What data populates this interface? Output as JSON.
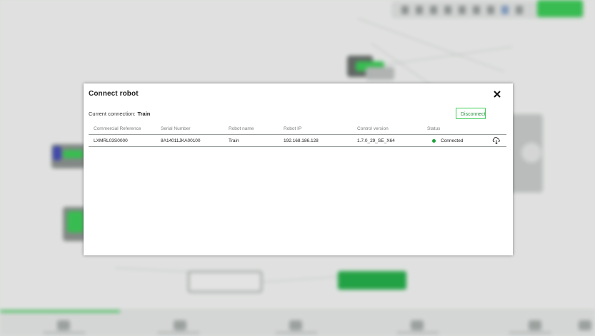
{
  "dialog": {
    "title": "Connect robot",
    "close_icon": "close-icon",
    "current_connection_label": "Current connection:",
    "current_connection_value": "Train",
    "disconnect_label": "Disconnect"
  },
  "table": {
    "columns": [
      "Commercial Reference",
      "Serial Number",
      "Robot name",
      "Robot IP",
      "Control version",
      "Status"
    ],
    "rows": [
      {
        "commercial_reference": "LXMRL03S0000",
        "serial_number": "8A14011JKA00100",
        "robot_name": "Train",
        "robot_ip": "192.168.186.128",
        "control_version": "1.7.0_29_SE_X64",
        "status": "Connected",
        "status_color": "#1f9e3a",
        "action_icon": "cloud-download-icon"
      }
    ]
  },
  "colors": {
    "accent": "#3dcd58",
    "accent_text": "#2a8f3f",
    "overlay": "rgba(0,0,0,0.08)"
  }
}
